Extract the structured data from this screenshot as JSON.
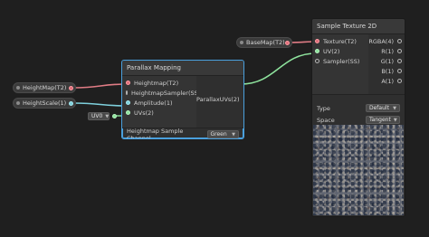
{
  "properties": {
    "heightmap": "HeightMap(T2)",
    "heightscale": "HeightScale(1)",
    "basemap": "BaseMap(T2)"
  },
  "uv_input": {
    "value": "UV0"
  },
  "parallax": {
    "title": "Parallax Mapping",
    "inputs": [
      "Heightmap(T2)",
      "HeightmapSampler(SS)",
      "Amplitude(1)",
      "UVs(2)"
    ],
    "output": "ParallaxUVs(2)",
    "channel_label": "Heightmap Sample Channel",
    "channel_value": "Green"
  },
  "sample": {
    "title": "Sample Texture 2D",
    "inputs": [
      "Texture(T2)",
      "UV(2)",
      "Sampler(SS)"
    ],
    "outputs": [
      "RGBA(4)",
      "R(1)",
      "G(1)",
      "B(1)",
      "A(1)"
    ],
    "type_label": "Type",
    "type_value": "Default",
    "space_label": "Space",
    "space_value": "Tangent"
  },
  "colors": {
    "texture_port": "#e06f7a",
    "float_port": "#7ed0dc",
    "vector2_port": "#8ee39d",
    "selection": "#4aa0dd"
  }
}
